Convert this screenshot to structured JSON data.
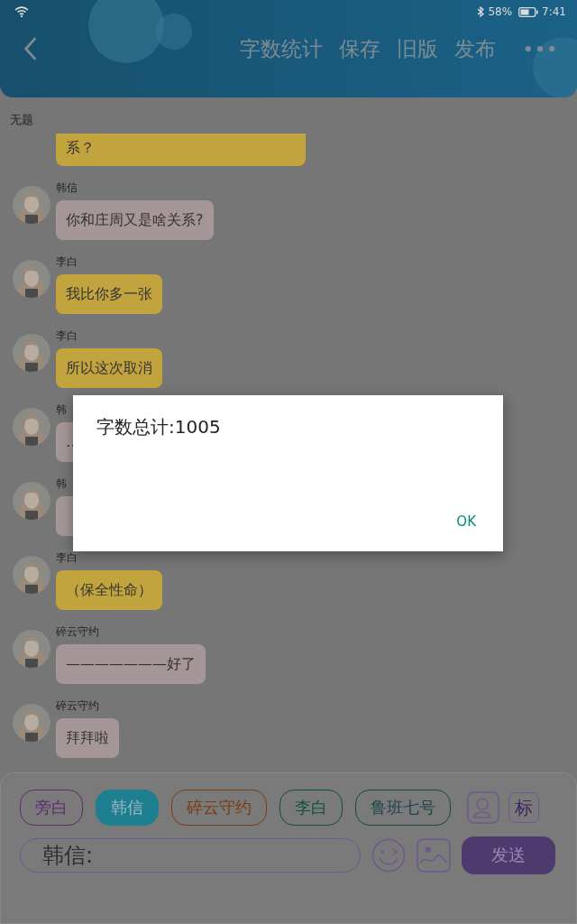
{
  "status_bar": {
    "battery": "58%",
    "time": "7:41"
  },
  "header": {
    "actions": [
      "字数统计",
      "保存",
      "旧版",
      "发布"
    ]
  },
  "title": "无题",
  "messages": [
    {
      "kind": "continued",
      "text": "系？",
      "color": "#c2a43e"
    },
    {
      "kind": "message",
      "name": "韩信",
      "text": "你和庄周又是啥关系?",
      "color": "#a59797"
    },
    {
      "kind": "message",
      "name": "李白",
      "text": "我比你多一张",
      "color": "#c2a43e"
    },
    {
      "kind": "message",
      "name": "李白",
      "text": "所以这次取消",
      "color": "#c2a43e"
    },
    {
      "kind": "message",
      "name": "韩",
      "text": "…",
      "color": "#a59797"
    },
    {
      "kind": "covered",
      "name": "韩",
      "color": "#a59797"
    },
    {
      "kind": "message",
      "name": "李白",
      "text": "（保全性命）",
      "color": "#c2a43e"
    },
    {
      "kind": "message",
      "name": "碎云守约",
      "text": "———————好了",
      "color": "#a59797"
    },
    {
      "kind": "message",
      "name": "碎云守约",
      "text": "拜拜啦",
      "color": "#a59797"
    }
  ],
  "dialog": {
    "text": "字数总计:1005",
    "button": "OK"
  },
  "speakers": [
    {
      "label": "旁白",
      "color": "#5e2a72",
      "selected": false
    },
    {
      "label": "韩信",
      "color": "#1e7f90",
      "selected": true
    },
    {
      "label": "碎云守约",
      "color": "#7f3a10",
      "selected": false
    },
    {
      "label": "李白",
      "color": "#0c5244",
      "selected": false
    },
    {
      "label": "鲁班七号",
      "color": "#1c454c",
      "selected": false
    }
  ],
  "tag_button": "标",
  "input": {
    "value": "韩信:"
  },
  "send_button": "发送"
}
